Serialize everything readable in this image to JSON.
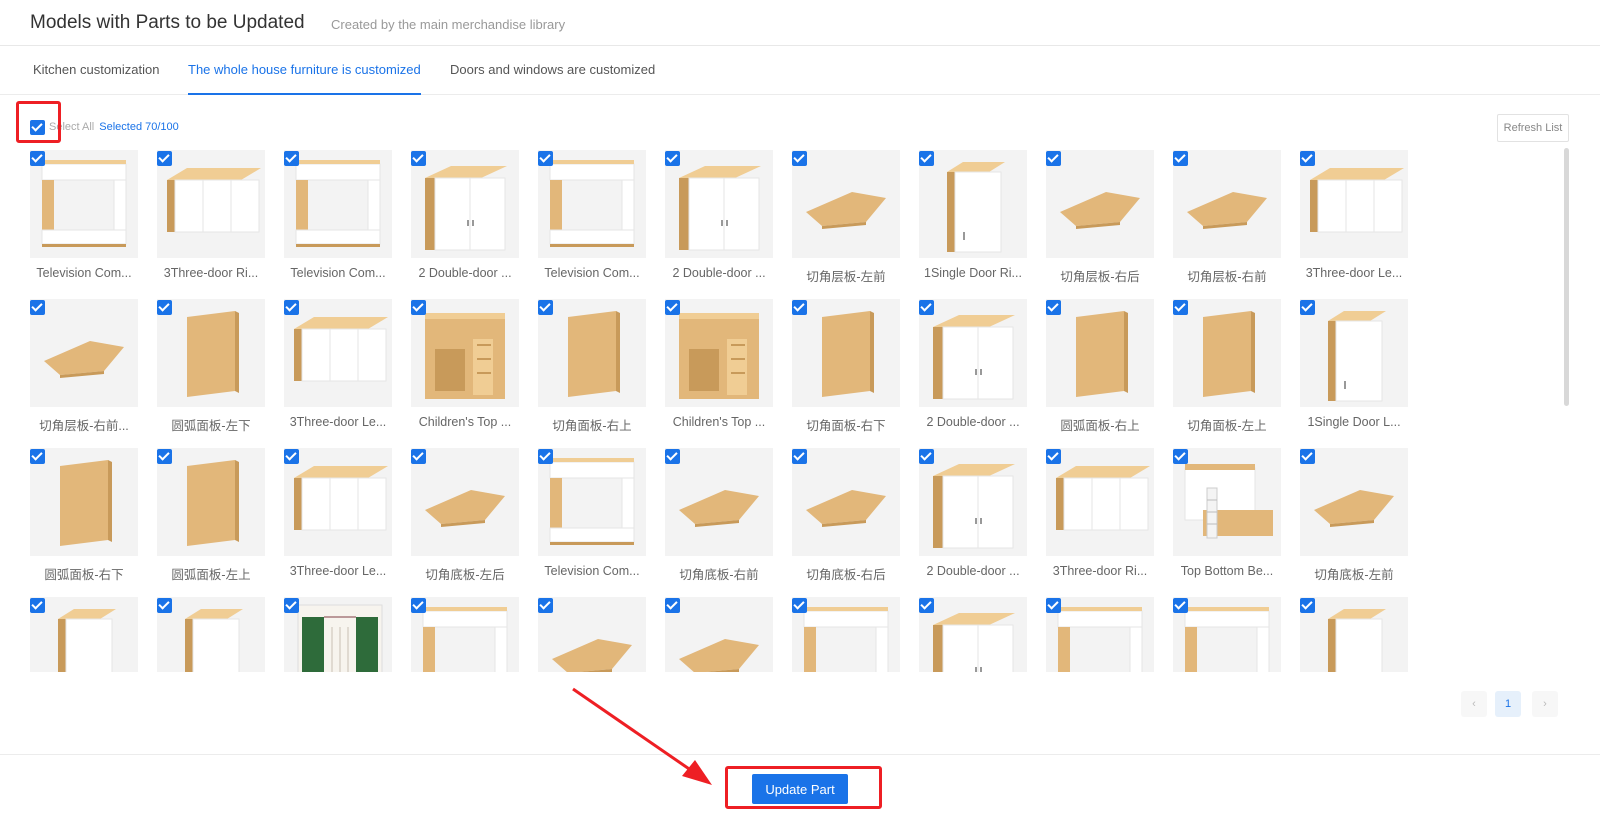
{
  "header": {
    "title": "Models with Parts to be Updated",
    "subtitle": "Created by the main merchandise library"
  },
  "tabs": [
    {
      "label": "Kitchen customization",
      "active": false
    },
    {
      "label": "The whole house furniture is customized",
      "active": true
    },
    {
      "label": "Doors and windows are customized",
      "active": false
    }
  ],
  "toolbar": {
    "select_all_label": "Select All",
    "selected_text": "Selected 70/100",
    "refresh_label": "Refresh List"
  },
  "items": [
    {
      "name": "Television Com...",
      "icon": "tv-wall-cabinet"
    },
    {
      "name": "3Three-door Ri...",
      "icon": "three-door-cabinet"
    },
    {
      "name": "Television Com...",
      "icon": "tv-wall-cabinet"
    },
    {
      "name": "2 Double-door ...",
      "icon": "two-door-cabinet"
    },
    {
      "name": "Television Com...",
      "icon": "tv-wall-cabinet"
    },
    {
      "name": "2 Double-door ...",
      "icon": "two-door-cabinet"
    },
    {
      "name": "切角层板-左前",
      "icon": "corner-shelf-board"
    },
    {
      "name": "1Single Door Ri...",
      "icon": "single-door-cabinet"
    },
    {
      "name": "切角层板-右后",
      "icon": "corner-shelf-board"
    },
    {
      "name": "切角层板-右前",
      "icon": "corner-shelf-board"
    },
    {
      "name": "3Three-door Le...",
      "icon": "three-door-cabinet"
    },
    {
      "name": "切角层板-右前...",
      "icon": "corner-shelf-board"
    },
    {
      "name": "圆弧面板-左下",
      "icon": "wood-panel"
    },
    {
      "name": "3Three-door Le...",
      "icon": "three-door-cabinet"
    },
    {
      "name": "Children's Top ...",
      "icon": "loft-bed"
    },
    {
      "name": "切角面板-右上",
      "icon": "wood-panel"
    },
    {
      "name": "Children's Top ...",
      "icon": "loft-bed"
    },
    {
      "name": "切角面板-右下",
      "icon": "wood-panel"
    },
    {
      "name": "2 Double-door ...",
      "icon": "two-door-cabinet"
    },
    {
      "name": "圆弧面板-右上",
      "icon": "wood-panel"
    },
    {
      "name": "切角面板-左上",
      "icon": "wood-panel"
    },
    {
      "name": "1Single Door L...",
      "icon": "single-door-cabinet"
    },
    {
      "name": "圆弧面板-右下",
      "icon": "wood-panel"
    },
    {
      "name": "圆弧面板-左上",
      "icon": "wood-panel"
    },
    {
      "name": "3Three-door Le...",
      "icon": "three-door-cabinet"
    },
    {
      "name": "切角底板-左后",
      "icon": "corner-shelf-board"
    },
    {
      "name": "Television Com...",
      "icon": "tv-wall-cabinet"
    },
    {
      "name": "切角底板-右前",
      "icon": "corner-shelf-board"
    },
    {
      "name": "切角底板-右后",
      "icon": "corner-shelf-board"
    },
    {
      "name": "2 Double-door ...",
      "icon": "two-door-cabinet"
    },
    {
      "name": "3Three-door Ri...",
      "icon": "three-door-cabinet"
    },
    {
      "name": "Top Bottom Be...",
      "icon": "bunk-bed"
    },
    {
      "name": "切角底板-左前",
      "icon": "corner-shelf-board"
    },
    {
      "name": "",
      "icon": "single-door-cabinet"
    },
    {
      "name": "",
      "icon": "single-door-cabinet"
    },
    {
      "name": "",
      "icon": "wardrobe-curtain"
    },
    {
      "name": "",
      "icon": "tv-wall-cabinet"
    },
    {
      "name": "",
      "icon": "corner-shelf-board"
    },
    {
      "name": "",
      "icon": "corner-shelf-board"
    },
    {
      "name": "",
      "icon": "tv-wall-cabinet"
    },
    {
      "name": "",
      "icon": "two-door-cabinet"
    },
    {
      "name": "",
      "icon": "tv-wall-cabinet"
    },
    {
      "name": "",
      "icon": "tv-wall-cabinet"
    },
    {
      "name": "",
      "icon": "single-door-cabinet"
    }
  ],
  "pagination": {
    "prev": "‹",
    "current": "1",
    "next": "›"
  },
  "footer": {
    "update_label": "Update Part"
  },
  "colors": {
    "accent": "#1a73e8",
    "annotation": "#ee1f24",
    "wood": "#e2b77a",
    "white_panel": "#ffffff"
  }
}
